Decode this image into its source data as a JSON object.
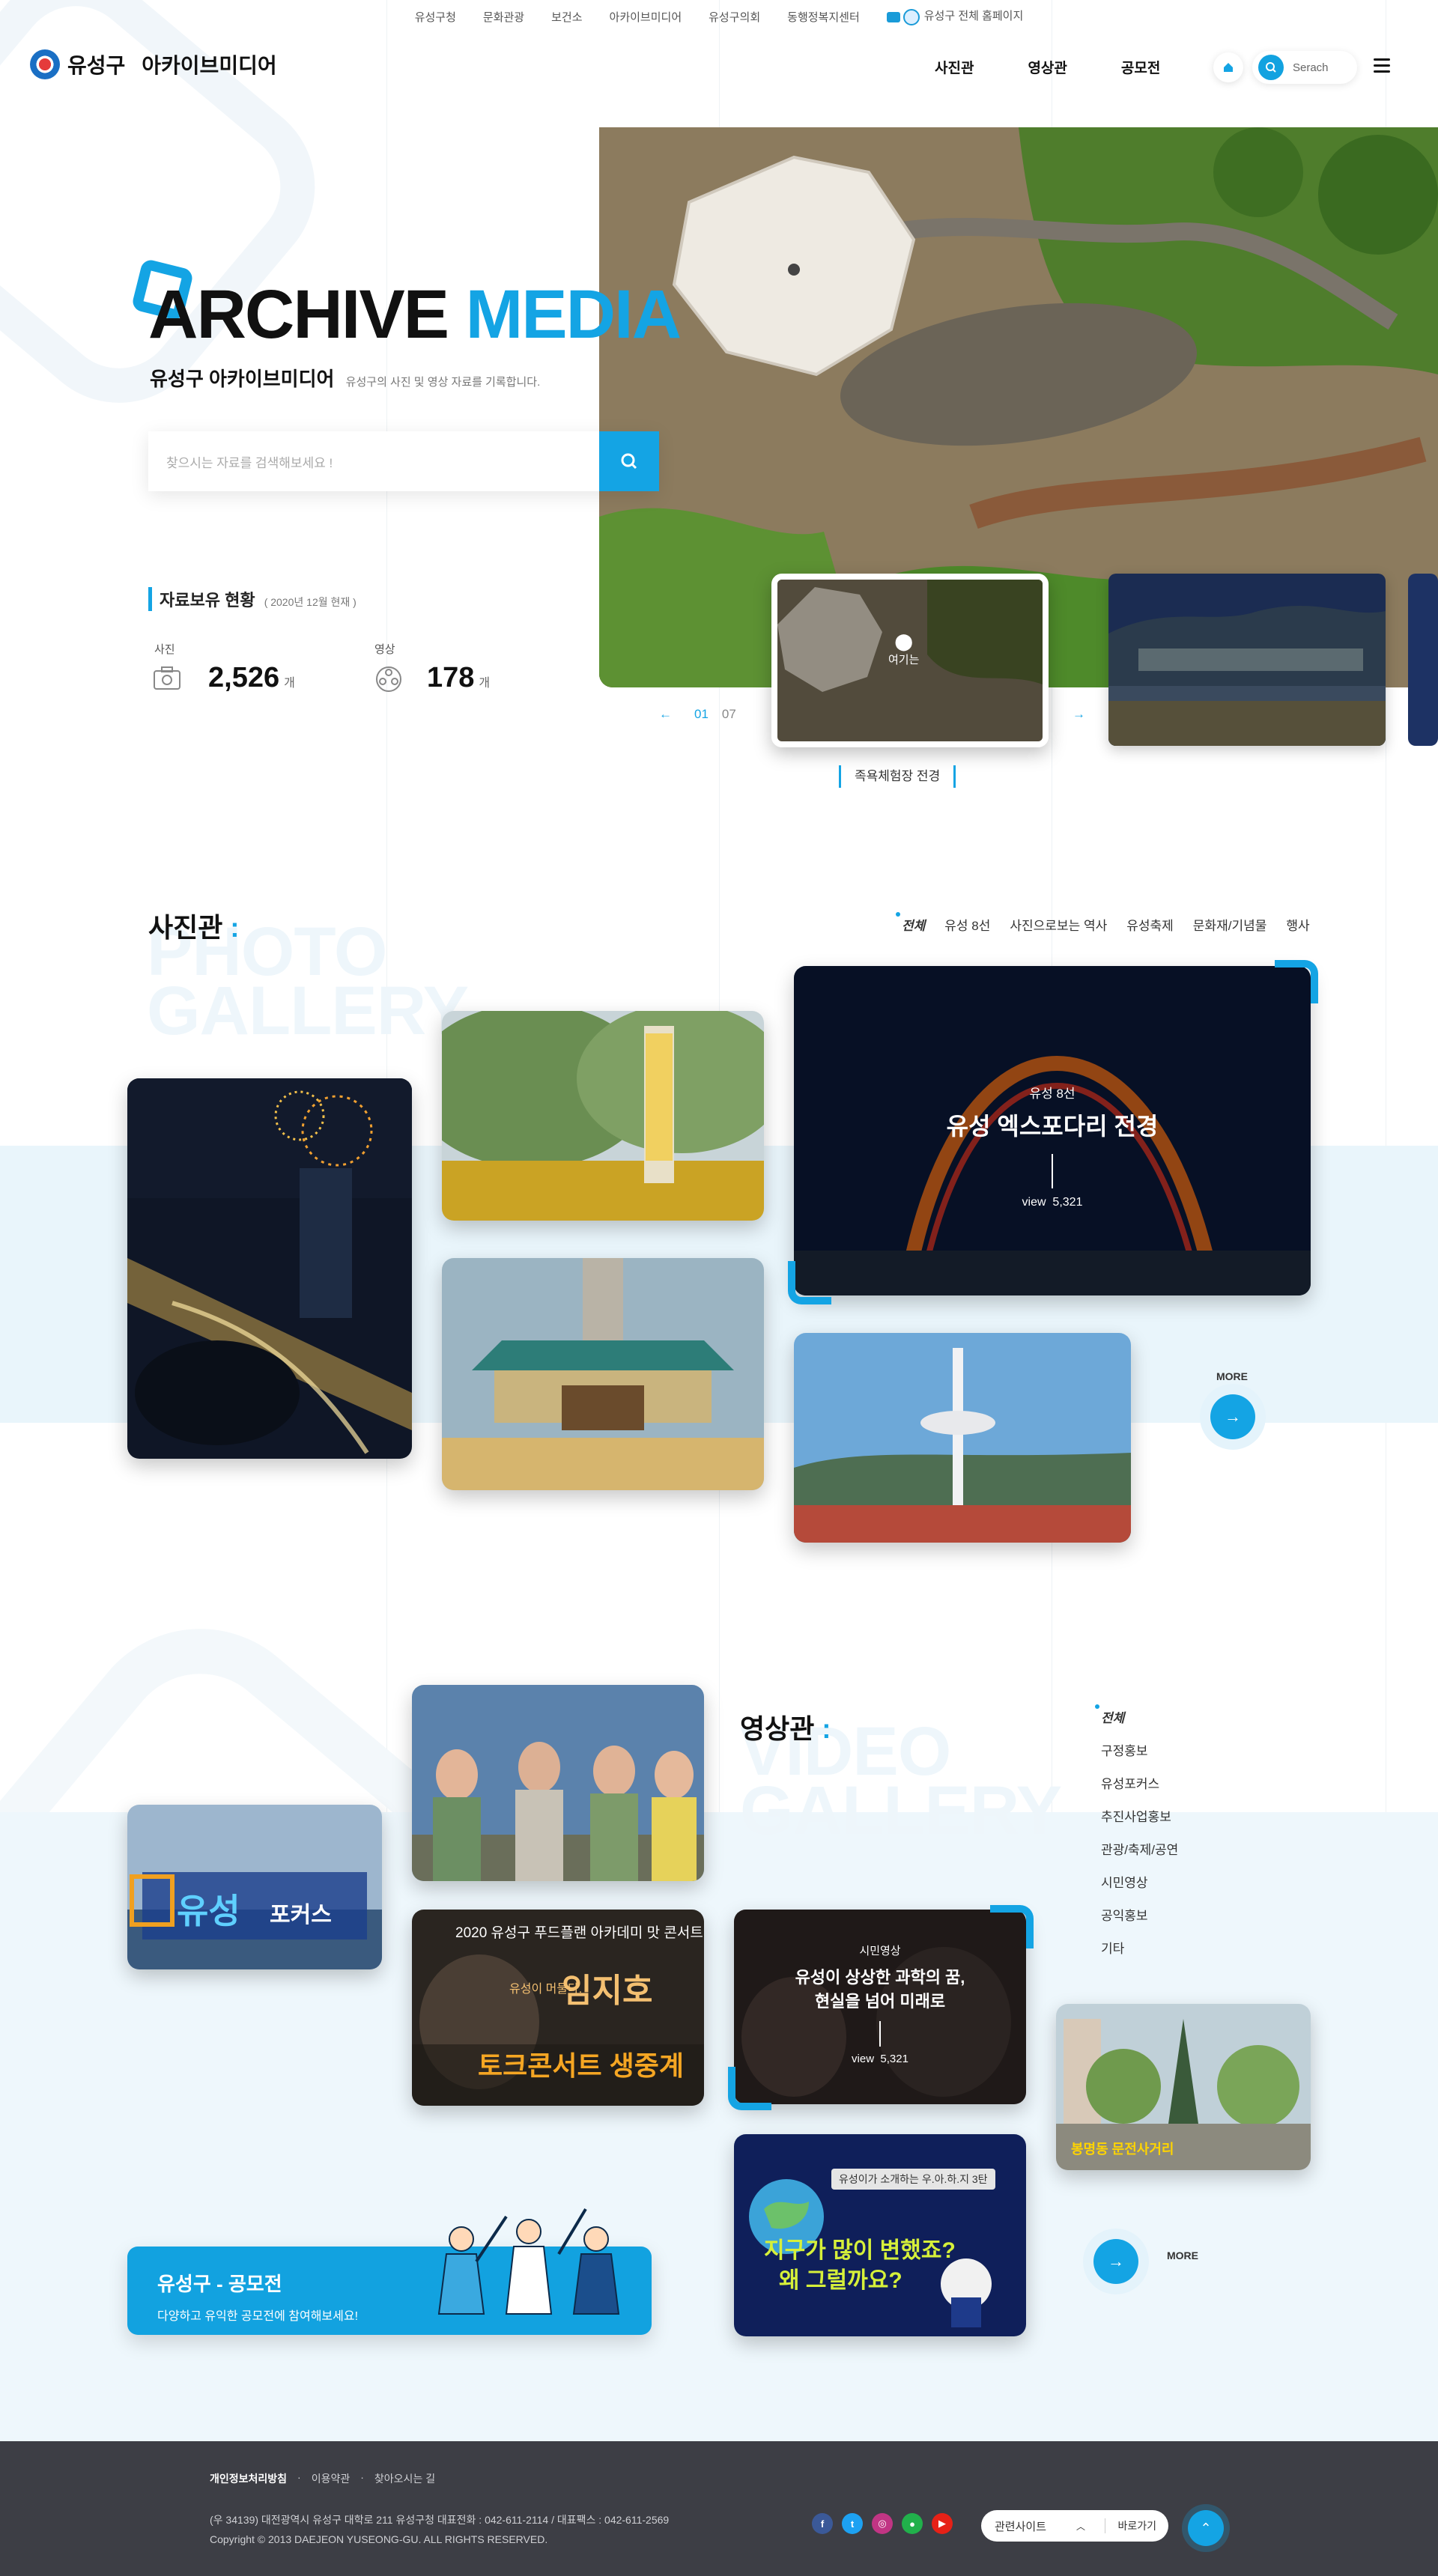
{
  "util_nav": [
    "유성구청",
    "문화관광",
    "보건소",
    "아카이브미디어",
    "유성구의회",
    "동행정복지센터"
  ],
  "util_home_label": "유성구 전체 홈페이지",
  "logo": {
    "name": "유성구",
    "sub": "아카이브미디어"
  },
  "gnb": [
    "사진관",
    "영상관",
    "공모전"
  ],
  "search_pill_label": "Serach",
  "hero": {
    "title_black": "ARCHIVE",
    "title_blue": "MEDIA",
    "subtitle": "유성구 아카이브미디어",
    "subtitle_small": "유성구의 사진 및 영상 자료를 기록합니다.",
    "search_placeholder": "찾으시는 자료를 검색해보세요 !",
    "stat_title": "자료보유 현황",
    "stat_date": "( 2020년 12월 현재 )",
    "photo_label": "사진",
    "photo_count": "2,526",
    "video_label": "영상",
    "video_count": "178",
    "unit": "개",
    "pager_current": "01",
    "pager_total": "07",
    "pin_label": "여기는",
    "caption": "족욕체험장 전경"
  },
  "photo_gallery": {
    "title": "사진관",
    "ghost1": "PHOTO",
    "ghost2": "GALLERY",
    "tabs": [
      "전체",
      "유성 8선",
      "사진으로보는 역사",
      "유성축제",
      "문화재/기념물",
      "행사"
    ],
    "featured": {
      "category": "유성 8선",
      "title": "유성 엑스포다리 전경",
      "view_label": "view",
      "view_count": "5,321"
    },
    "more": "MORE"
  },
  "video_gallery": {
    "title": "영상관",
    "ghost1": "VIDEO",
    "ghost2": "GALLERY",
    "categories": [
      "전체",
      "구정홍보",
      "유성포커스",
      "추진사업홍보",
      "관광/축제/공연",
      "시민영상",
      "공익홍보",
      "기타"
    ],
    "featured": {
      "category": "시민영상",
      "title_line1": "유성이 상상한 과학의 꿈,",
      "title_line2": "현실을 넘어 미래로",
      "view_label": "view",
      "view_count": "5,321"
    },
    "thumb_focus_title": "유성",
    "thumb_focus_sub": "포커스",
    "thumb_concert_top": "2020 유성구 푸드플랜 아카데미 맛 콘서트",
    "thumb_concert_name": "임지호",
    "thumb_concert_pre": "유성이 머물다.",
    "thumb_concert_main": "토크콘서트 생중계",
    "thumb_sci_banner": "유성이가 소개하는 우.아.하.지 3탄",
    "thumb_sci_line1": "지구가 많이 변했죠?",
    "thumb_sci_line2": "왜 그럴까요?",
    "thumb_street": "봉명동 문전사거리",
    "more": "MORE"
  },
  "contest": {
    "title": "유성구 - 공모전",
    "desc": "다양하고 유익한 공모전에 참여해보세요!"
  },
  "footer": {
    "links": [
      "개인정보처리방침",
      "이용약관",
      "찾아오시는 길"
    ],
    "address": "(우 34139) 대전광역시 유성구 대학로 211    유성구청 대표전화 : 042-611-2114 / 대표팩스 : 042-611-2569",
    "copyright": "Copyright © 2013 DAEJEON YUSEONG-GU. ALL RIGHTS RESERVED.",
    "related_label": "관련사이트",
    "go_label": "바로가기",
    "sns": [
      "facebook-icon",
      "twitter-icon",
      "instagram-icon",
      "talk-icon",
      "youtube-icon"
    ]
  },
  "colors": {
    "accent": "#14a4e4",
    "footer": "#3d3e45",
    "band": "#e9f5fb"
  }
}
